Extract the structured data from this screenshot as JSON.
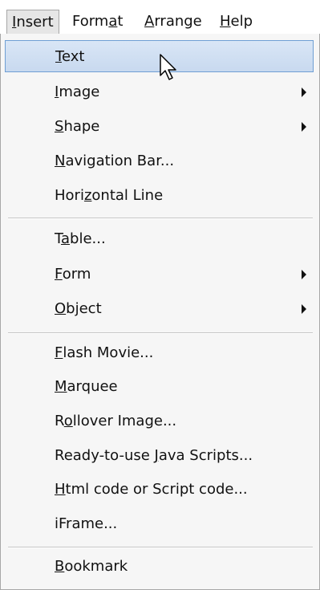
{
  "menubar": {
    "items": [
      {
        "pre": "",
        "u": "I",
        "post": "nsert"
      },
      {
        "pre": "Form",
        "u": "a",
        "post": "t"
      },
      {
        "pre": "",
        "u": "A",
        "post": "rrange"
      },
      {
        "pre": "",
        "u": "H",
        "post": "elp"
      }
    ]
  },
  "menu": {
    "items": [
      {
        "pre": "",
        "u": "T",
        "post": "ext"
      },
      {
        "pre": "",
        "u": "I",
        "post": "mage"
      },
      {
        "pre": "",
        "u": "S",
        "post": "hape"
      },
      {
        "pre": "",
        "u": "N",
        "post": "avigation Bar..."
      },
      {
        "pre": "Hori",
        "u": "z",
        "post": "ontal Line"
      },
      {
        "pre": "T",
        "u": "a",
        "post": "ble..."
      },
      {
        "pre": "",
        "u": "F",
        "post": "orm"
      },
      {
        "pre": "",
        "u": "O",
        "post": "bject"
      },
      {
        "pre": "",
        "u": "F",
        "post": "lash Movie..."
      },
      {
        "pre": "",
        "u": "M",
        "post": "arquee"
      },
      {
        "pre": "R",
        "u": "o",
        "post": "llover Image..."
      },
      {
        "pre": "Ready-to-use ",
        "u": "J",
        "post": "ava Scripts..."
      },
      {
        "pre": "",
        "u": "H",
        "post": "tml code or Script code..."
      },
      {
        "pre": "iFrame...",
        "u": "",
        "post": ""
      },
      {
        "pre": "",
        "u": "B",
        "post": "ookmark"
      }
    ]
  }
}
